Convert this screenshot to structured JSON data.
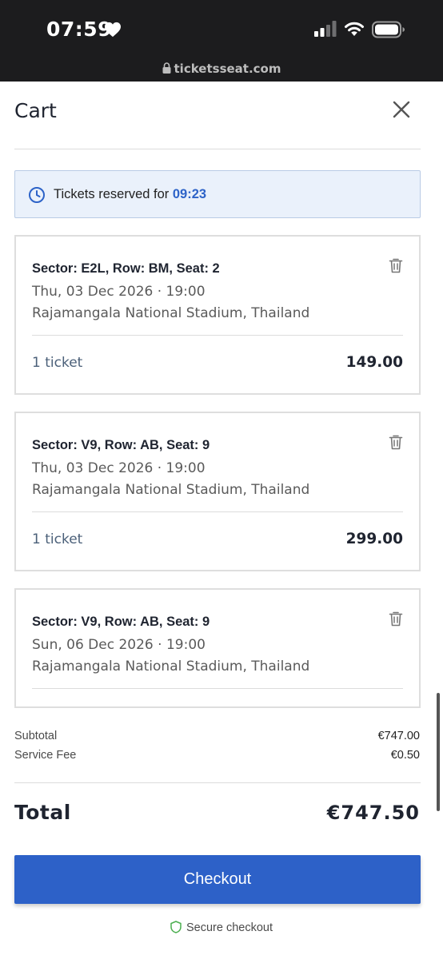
{
  "status_bar": {
    "time": "07:59",
    "url": "ticketsseat.com",
    "icons": [
      "heart-icon",
      "signal-icon",
      "wifi-icon",
      "battery-icon",
      "lock-icon"
    ]
  },
  "header": {
    "title": "Cart",
    "close_icon": "close-icon"
  },
  "timer": {
    "label": "Tickets reserved for",
    "countdown": "09:23",
    "icon": "clock-icon"
  },
  "tickets": [
    {
      "title": "Sector: E2L, Row: BM, Seat: 2",
      "date": "Thu, 03 Dec 2026 · 19:00",
      "venue": "Rajamangala National Stadium, Thailand",
      "quantity": "1 ticket",
      "price": "149.00"
    },
    {
      "title": "Sector: V9, Row: AB, Seat: 9",
      "date": "Thu, 03 Dec 2026 · 19:00",
      "venue": "Rajamangala National Stadium, Thailand",
      "quantity": "1 ticket",
      "price": "299.00"
    },
    {
      "title": "Sector: V9, Row: AB, Seat: 9",
      "date": "Sun, 06 Dec 2026 · 19:00",
      "venue": "Rajamangala National Stadium, Thailand"
    }
  ],
  "summary": {
    "subtotal_label": "Subtotal",
    "subtotal_value": "€747.00",
    "fee_label": "Service Fee",
    "fee_value": "€0.50",
    "total_label": "Total",
    "total_value": "€747.50"
  },
  "checkout": {
    "button_label": "Checkout",
    "secure_label": "Secure checkout"
  },
  "colors": {
    "accent": "#2d61c8",
    "timer_bg": "#eaf1fb",
    "status_bar": "#1c1c1e"
  }
}
